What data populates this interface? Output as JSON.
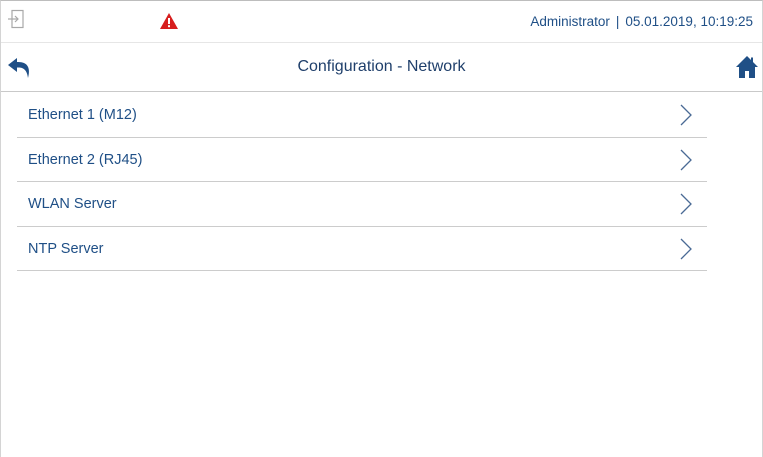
{
  "status_bar": {
    "user": "Administrator",
    "separator": "|",
    "datetime": "05.01.2019, 10:19:25",
    "warning_color": "#d71e1e"
  },
  "header": {
    "title": "Configuration - Network",
    "back_icon": "back-arrow-icon",
    "home_icon": "home-icon"
  },
  "menu": {
    "items": [
      {
        "label": "Ethernet 1 (M12)"
      },
      {
        "label": "Ethernet 2 (RJ45)"
      },
      {
        "label": "WLAN Server"
      },
      {
        "label": "NTP Server"
      }
    ]
  },
  "colors": {
    "text": "#1f4f86",
    "icon": "#1f4f86",
    "divider": "#cccccc"
  }
}
